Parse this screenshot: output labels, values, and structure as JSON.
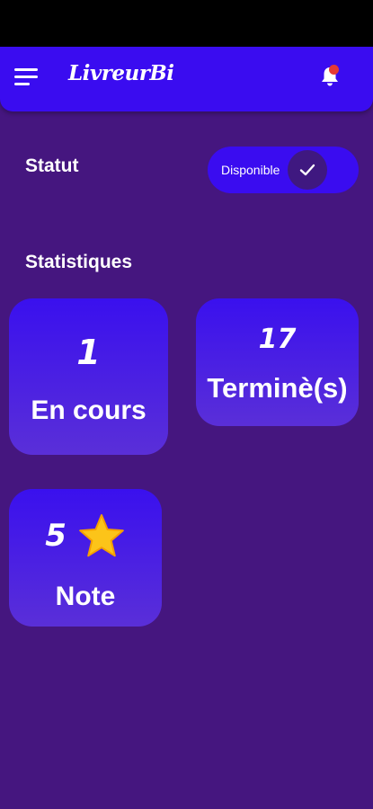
{
  "header": {
    "brand": "LivreurBi",
    "menu_icon": "hamburger-menu-icon",
    "notification_icon": "bell-icon",
    "notification_badge_color": "#e53935",
    "accent_color": "#3a0cf0"
  },
  "status": {
    "label": "Statut",
    "toggle_text": "Disponible",
    "toggle_on": true,
    "toggle_icon": "check-icon"
  },
  "stats": {
    "title": "Statistiques",
    "cards": [
      {
        "value": "1",
        "label": "En cours"
      },
      {
        "value": "17",
        "label": "Terminè(s)"
      },
      {
        "value": "5",
        "label": "Note",
        "icon": "star-icon"
      }
    ]
  }
}
